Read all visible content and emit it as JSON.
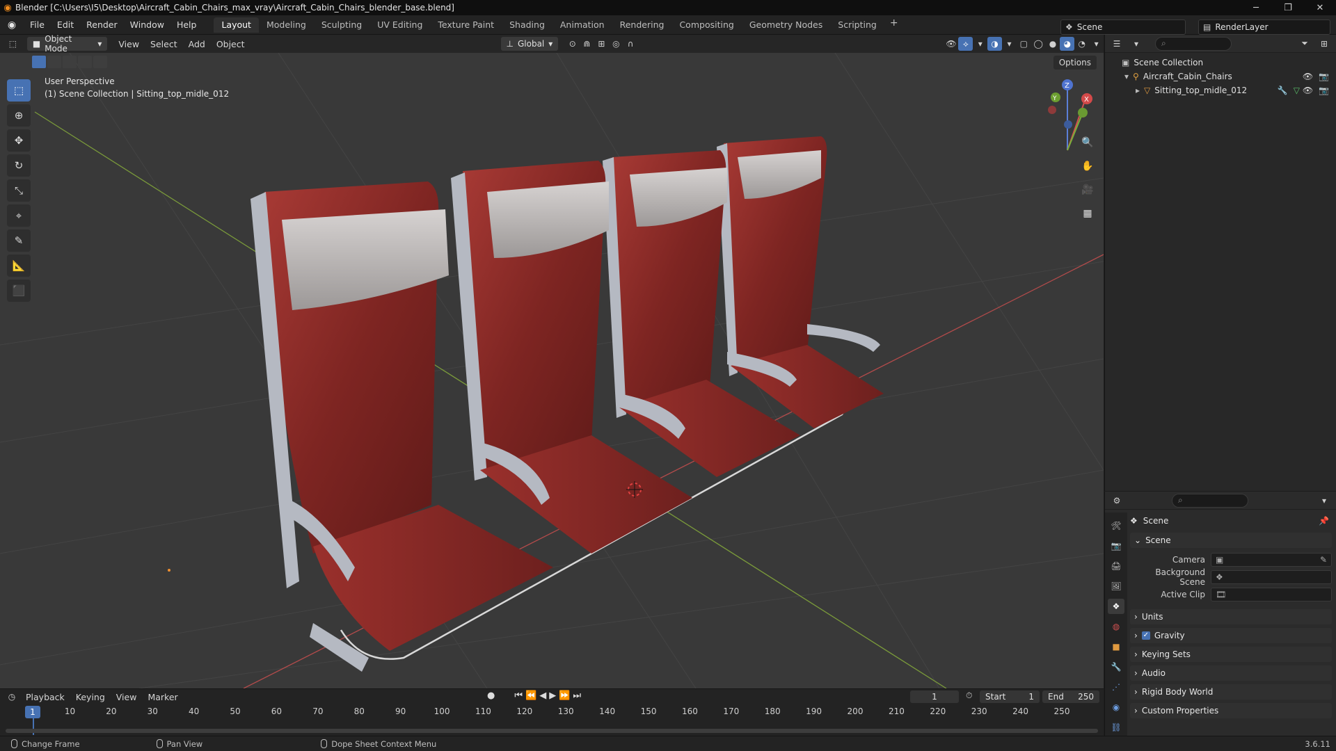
{
  "window": {
    "title": "Blender [C:\\Users\\I5\\Desktop\\Aircraft_Cabin_Chairs_max_vray\\Aircraft_Cabin_Chairs_blender_base.blend]"
  },
  "menu": [
    "File",
    "Edit",
    "Render",
    "Window",
    "Help"
  ],
  "workspaces": [
    "Layout",
    "Modeling",
    "Sculpting",
    "UV Editing",
    "Texture Paint",
    "Shading",
    "Animation",
    "Rendering",
    "Compositing",
    "Geometry Nodes",
    "Scripting"
  ],
  "scene_selector": {
    "scene": "Scene",
    "view_layer": "RenderLayer"
  },
  "viewport_header": {
    "mode": "Object Mode",
    "menus": [
      "View",
      "Select",
      "Add",
      "Object"
    ],
    "transform_orientation": "Global",
    "options_label": "Options"
  },
  "viewport": {
    "perspective_label": "User Perspective",
    "context_label": "(1) Scene Collection | Sitting_top_midle_012",
    "gizmo": {
      "x": "X",
      "y": "Y",
      "z": "Z"
    },
    "colors": {
      "grid_bg": "#393939",
      "seat": "#8a2a27",
      "headrest": "#b8b4b3",
      "frame": "#b5b9c2",
      "x_axis": "#b34b4b",
      "y_axis": "#7a9a3a"
    }
  },
  "outliner": {
    "root": "Scene Collection",
    "items": [
      {
        "name": "Aircraft_Cabin_Chairs",
        "icon": "armature-icon"
      },
      {
        "name": "Sitting_top_midle_012",
        "icon": "mesh-icon"
      }
    ]
  },
  "properties": {
    "context_title": "Scene",
    "section": "Scene",
    "fields": [
      {
        "label": "Camera",
        "value": ""
      },
      {
        "label": "Background Scene",
        "value": ""
      },
      {
        "label": "Active Clip",
        "value": ""
      }
    ],
    "panels": [
      "Units",
      "Gravity",
      "Keying Sets",
      "Audio",
      "Rigid Body World",
      "Custom Properties"
    ],
    "gravity_checked": true
  },
  "timeline": {
    "menus": [
      "Playback",
      "Keying",
      "View",
      "Marker"
    ],
    "current_frame": "1",
    "start_label": "Start",
    "start": "1",
    "end_label": "End",
    "end": "250",
    "ruler": [
      "1",
      "10",
      "20",
      "30",
      "40",
      "50",
      "60",
      "70",
      "80",
      "90",
      "100",
      "110",
      "120",
      "130",
      "140",
      "150",
      "160",
      "170",
      "180",
      "190",
      "200",
      "210",
      "220",
      "230",
      "240",
      "250"
    ]
  },
  "statusbar": {
    "items": [
      "Change Frame",
      "Pan View",
      "Dope Sheet Context Menu"
    ],
    "version": "3.6.11"
  }
}
